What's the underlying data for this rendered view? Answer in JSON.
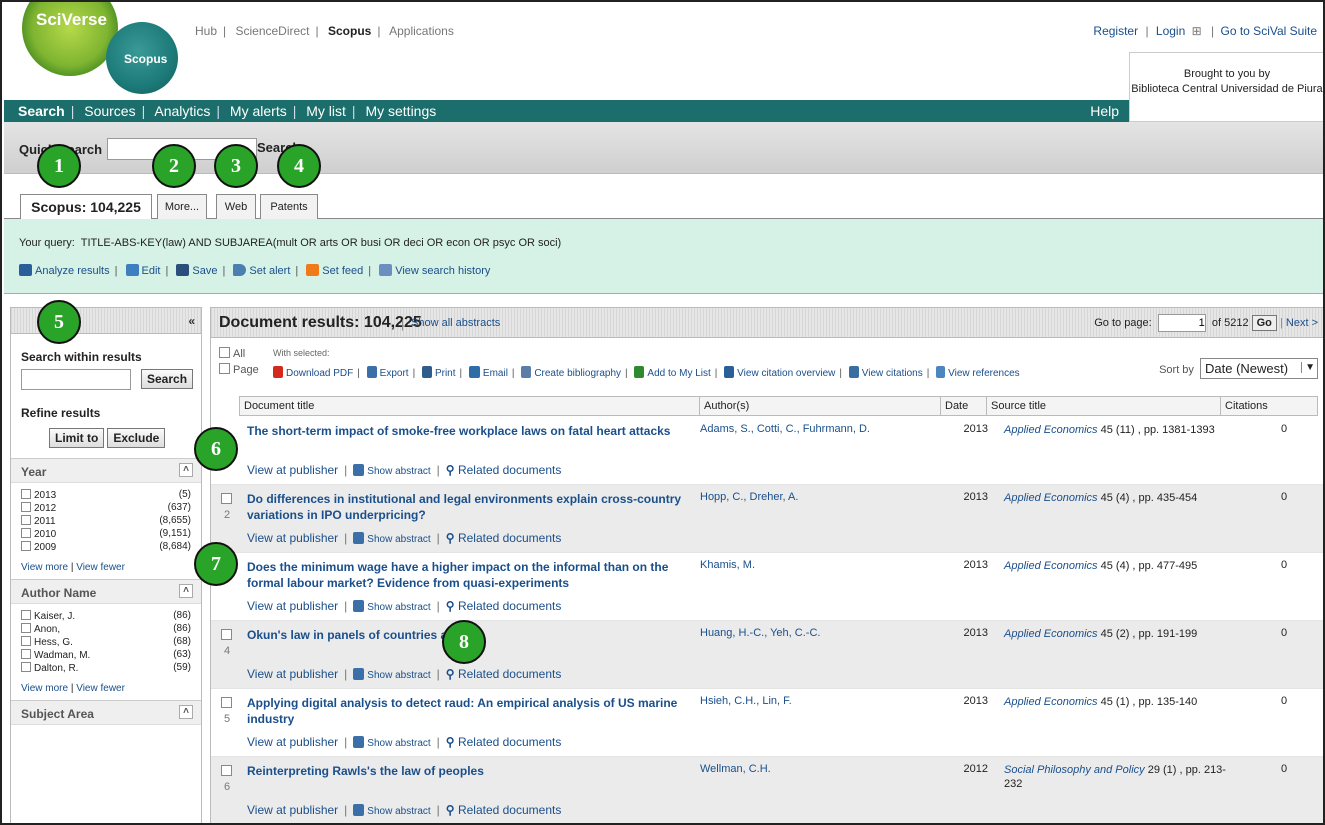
{
  "header": {
    "logo_text": "SciVerse",
    "logo_sub": "Scopus",
    "topnav": [
      {
        "label": "Hub"
      },
      {
        "label": "ScienceDirect"
      },
      {
        "label": "Scopus"
      },
      {
        "label": "Applications"
      }
    ],
    "register": "Register",
    "login": "Login",
    "login_icon": "⊞",
    "scival": "Go to SciVal Suite",
    "brought_line1": "Brought to you by",
    "brought_line2": "Biblioteca Central Universidad de Piura"
  },
  "mainnav": {
    "items": [
      {
        "label": "Search"
      },
      {
        "label": "Sources"
      },
      {
        "label": "Analytics"
      },
      {
        "label": "My alerts"
      },
      {
        "label": "My list"
      },
      {
        "label": "My settings"
      }
    ],
    "help": "Help"
  },
  "quick_search": {
    "label": "Quick Search",
    "button": "Search",
    "value": ""
  },
  "tabs": [
    {
      "label": "Scopus: 104,225"
    },
    {
      "label": "More..."
    },
    {
      "label": "Web"
    },
    {
      "label": "Patents"
    }
  ],
  "query": {
    "prefix": "Your query:",
    "text": "TITLE-ABS-KEY(law) AND SUBJAREA(mult OR arts OR busi OR deci OR econ OR psyc OR soci)",
    "actions": [
      {
        "label": "Analyze results"
      },
      {
        "label": "Edit"
      },
      {
        "label": "Save"
      },
      {
        "label": "Set alert"
      },
      {
        "label": "Set feed"
      },
      {
        "label": "View search history"
      }
    ]
  },
  "sidebar": {
    "collapse": "«",
    "search_title": "Search within results",
    "search_button": "Search",
    "refine_title": "Refine results",
    "limit": "Limit to",
    "exclude": "Exclude",
    "year_title": "Year",
    "years": [
      {
        "label": "2013",
        "count": "(5)"
      },
      {
        "label": "2012",
        "count": "(637)"
      },
      {
        "label": "2011",
        "count": "(8,655)"
      },
      {
        "label": "2010",
        "count": "(9,151)"
      },
      {
        "label": "2009",
        "count": "(8,684)"
      }
    ],
    "author_title": "Author Name",
    "authors": [
      {
        "label": "Kaiser, J.",
        "count": "(86)"
      },
      {
        "label": "Anon,",
        "count": "(86)"
      },
      {
        "label": "Hess, G.",
        "count": "(68)"
      },
      {
        "label": "Wadman, M.",
        "count": "(63)"
      },
      {
        "label": "Dalton, R.",
        "count": "(59)"
      }
    ],
    "view_more": "View more",
    "view_fewer": "View fewer",
    "subject_title": "Subject Area"
  },
  "results": {
    "title": "Document results: 104,225",
    "show_all": "Show all abstracts",
    "goto_label": "Go to page:",
    "page": "1",
    "of_pages": "of 5212",
    "go": "Go",
    "next": "Next >",
    "all": "All",
    "page_cb": "Page",
    "with_selected": "With selected:",
    "actions": [
      {
        "label": "Download PDF"
      },
      {
        "label": "Export"
      },
      {
        "label": "Print"
      },
      {
        "label": "Email"
      },
      {
        "label": "Create bibliography"
      },
      {
        "label": "Add to My List"
      },
      {
        "label": "View citation overview"
      },
      {
        "label": "View citations"
      },
      {
        "label": "View references"
      }
    ],
    "sort_label": "Sort by",
    "sort_value": "Date (Newest)",
    "columns": {
      "title": "Document title",
      "authors": "Author(s)",
      "date": "Date",
      "source": "Source title",
      "citations": "Citations"
    },
    "link_publisher": "View at publisher",
    "link_abstract": "Show abstract",
    "link_related": "Related documents",
    "rows": [
      {
        "num": "",
        "title": "The short-term impact of smoke-free workplace laws on fatal heart attacks",
        "authors": "Adams, S., Cotti, C., Fuhrmann, D.",
        "date": "2013",
        "journal": "Applied Economics",
        "source_rest": " 45 (11) , pp. 1381-1393",
        "citations": "0"
      },
      {
        "num": "2",
        "title": "Do differences in institutional and legal environments explain cross-country variations in IPO underpricing?",
        "authors": "Hopp, C., Dreher, A.",
        "date": "2013",
        "journal": "Applied Economics",
        "source_rest": " 45 (4) , pp. 435-454",
        "citations": "0"
      },
      {
        "num": "",
        "title": "Does the minimum wage have a higher impact on the informal than on the formal labour market? Evidence from quasi-experiments",
        "authors": "Khamis, M.",
        "date": "2013",
        "journal": "Applied Economics",
        "source_rest": " 45 (4) , pp. 477-495",
        "citations": "0"
      },
      {
        "num": "4",
        "title": "Okun's law in panels of countries a",
        "authors": "Huang, H.-C., Yeh, C.-C.",
        "date": "2013",
        "journal": "Applied Economics",
        "source_rest": " 45 (2) , pp. 191-199",
        "citations": "0"
      },
      {
        "num": "5",
        "title": "Applying digital analysis to detect raud: An empirical analysis of US marine industry",
        "authors": "Hsieh, C.H., Lin, F.",
        "date": "2013",
        "journal": "Applied Economics",
        "source_rest": " 45 (1) , pp. 135-140",
        "citations": "0"
      },
      {
        "num": "6",
        "title": "Reinterpreting Rawls's the law of peoples",
        "authors": "Wellman, C.H.",
        "date": "2012",
        "journal": "Social Philosophy and Policy",
        "source_rest": " 29 (1) , pp. 213-232",
        "citations": "0"
      }
    ]
  },
  "badges": [
    "1",
    "2",
    "3",
    "4",
    "5",
    "6",
    "7",
    "8"
  ],
  "colors": {
    "nav": "#1b6e6b",
    "query_bg": "#d6f2e7",
    "badge": "#2aa329",
    "link": "#1a4f8b"
  }
}
